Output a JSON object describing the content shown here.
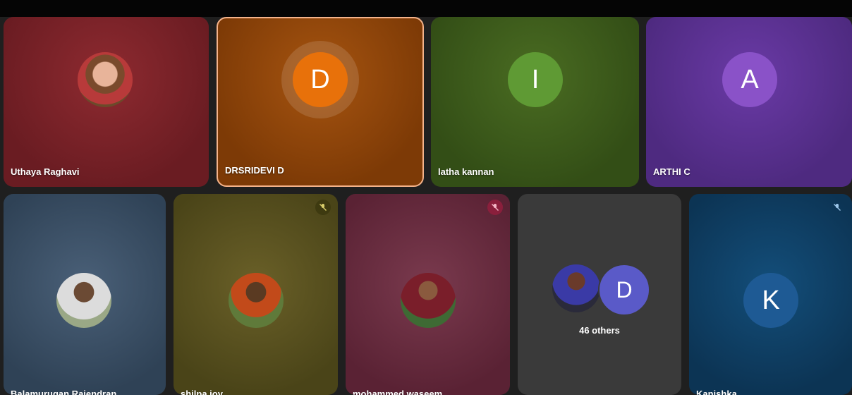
{
  "participants_row1": [
    {
      "name": "Uthaya Raghavi",
      "avatar": "photo",
      "initial": ""
    },
    {
      "name": "DRSRIDEVI D",
      "avatar": "initial",
      "initial": "D",
      "speaking": true
    },
    {
      "name": "latha kannan",
      "avatar": "initial",
      "initial": "I"
    },
    {
      "name": "ARTHI C",
      "avatar": "initial",
      "initial": "A"
    }
  ],
  "participants_row2": [
    {
      "name": "Balamurugan Rajendran",
      "avatar": "photo",
      "muted": false
    },
    {
      "name": "shilpa joy",
      "avatar": "photo",
      "muted": true
    },
    {
      "name": "mohammed waseem",
      "avatar": "photo",
      "muted": true
    },
    {
      "name": "Kanishka",
      "avatar": "initial",
      "initial": "K",
      "muted": true
    }
  ],
  "others": {
    "count_label": "46 others",
    "initial": "D"
  },
  "icons": {
    "mute": "mic-off-icon"
  },
  "colors": {
    "tile_uthaya": "#7a2228",
    "tile_drsridevi": "#8f4407",
    "tile_latha": "#3c5a1c",
    "tile_arthi": "#5a2f8c",
    "tile_bala": "#3b5066",
    "tile_shilpa": "#5a521e",
    "tile_mohammed": "#6a2a3e",
    "tile_others": "#3a3a3a",
    "tile_kanishka": "#0f3f66",
    "speaking_border": "#f5b38a"
  }
}
